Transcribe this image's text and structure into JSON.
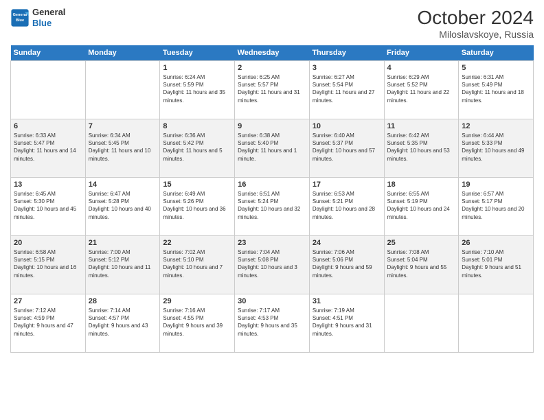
{
  "header": {
    "logo_line1": "General",
    "logo_line2": "Blue",
    "month": "October 2024",
    "location": "Miloslavskoye, Russia"
  },
  "days": [
    "Sunday",
    "Monday",
    "Tuesday",
    "Wednesday",
    "Thursday",
    "Friday",
    "Saturday"
  ],
  "weeks": [
    [
      {
        "day": "",
        "sunrise": "",
        "sunset": "",
        "daylight": ""
      },
      {
        "day": "",
        "sunrise": "",
        "sunset": "",
        "daylight": ""
      },
      {
        "day": "1",
        "sunrise": "Sunrise: 6:24 AM",
        "sunset": "Sunset: 5:59 PM",
        "daylight": "Daylight: 11 hours and 35 minutes."
      },
      {
        "day": "2",
        "sunrise": "Sunrise: 6:25 AM",
        "sunset": "Sunset: 5:57 PM",
        "daylight": "Daylight: 11 hours and 31 minutes."
      },
      {
        "day": "3",
        "sunrise": "Sunrise: 6:27 AM",
        "sunset": "Sunset: 5:54 PM",
        "daylight": "Daylight: 11 hours and 27 minutes."
      },
      {
        "day": "4",
        "sunrise": "Sunrise: 6:29 AM",
        "sunset": "Sunset: 5:52 PM",
        "daylight": "Daylight: 11 hours and 22 minutes."
      },
      {
        "day": "5",
        "sunrise": "Sunrise: 6:31 AM",
        "sunset": "Sunset: 5:49 PM",
        "daylight": "Daylight: 11 hours and 18 minutes."
      }
    ],
    [
      {
        "day": "6",
        "sunrise": "Sunrise: 6:33 AM",
        "sunset": "Sunset: 5:47 PM",
        "daylight": "Daylight: 11 hours and 14 minutes."
      },
      {
        "day": "7",
        "sunrise": "Sunrise: 6:34 AM",
        "sunset": "Sunset: 5:45 PM",
        "daylight": "Daylight: 11 hours and 10 minutes."
      },
      {
        "day": "8",
        "sunrise": "Sunrise: 6:36 AM",
        "sunset": "Sunset: 5:42 PM",
        "daylight": "Daylight: 11 hours and 5 minutes."
      },
      {
        "day": "9",
        "sunrise": "Sunrise: 6:38 AM",
        "sunset": "Sunset: 5:40 PM",
        "daylight": "Daylight: 11 hours and 1 minute."
      },
      {
        "day": "10",
        "sunrise": "Sunrise: 6:40 AM",
        "sunset": "Sunset: 5:37 PM",
        "daylight": "Daylight: 10 hours and 57 minutes."
      },
      {
        "day": "11",
        "sunrise": "Sunrise: 6:42 AM",
        "sunset": "Sunset: 5:35 PM",
        "daylight": "Daylight: 10 hours and 53 minutes."
      },
      {
        "day": "12",
        "sunrise": "Sunrise: 6:44 AM",
        "sunset": "Sunset: 5:33 PM",
        "daylight": "Daylight: 10 hours and 49 minutes."
      }
    ],
    [
      {
        "day": "13",
        "sunrise": "Sunrise: 6:45 AM",
        "sunset": "Sunset: 5:30 PM",
        "daylight": "Daylight: 10 hours and 45 minutes."
      },
      {
        "day": "14",
        "sunrise": "Sunrise: 6:47 AM",
        "sunset": "Sunset: 5:28 PM",
        "daylight": "Daylight: 10 hours and 40 minutes."
      },
      {
        "day": "15",
        "sunrise": "Sunrise: 6:49 AM",
        "sunset": "Sunset: 5:26 PM",
        "daylight": "Daylight: 10 hours and 36 minutes."
      },
      {
        "day": "16",
        "sunrise": "Sunrise: 6:51 AM",
        "sunset": "Sunset: 5:24 PM",
        "daylight": "Daylight: 10 hours and 32 minutes."
      },
      {
        "day": "17",
        "sunrise": "Sunrise: 6:53 AM",
        "sunset": "Sunset: 5:21 PM",
        "daylight": "Daylight: 10 hours and 28 minutes."
      },
      {
        "day": "18",
        "sunrise": "Sunrise: 6:55 AM",
        "sunset": "Sunset: 5:19 PM",
        "daylight": "Daylight: 10 hours and 24 minutes."
      },
      {
        "day": "19",
        "sunrise": "Sunrise: 6:57 AM",
        "sunset": "Sunset: 5:17 PM",
        "daylight": "Daylight: 10 hours and 20 minutes."
      }
    ],
    [
      {
        "day": "20",
        "sunrise": "Sunrise: 6:58 AM",
        "sunset": "Sunset: 5:15 PM",
        "daylight": "Daylight: 10 hours and 16 minutes."
      },
      {
        "day": "21",
        "sunrise": "Sunrise: 7:00 AM",
        "sunset": "Sunset: 5:12 PM",
        "daylight": "Daylight: 10 hours and 11 minutes."
      },
      {
        "day": "22",
        "sunrise": "Sunrise: 7:02 AM",
        "sunset": "Sunset: 5:10 PM",
        "daylight": "Daylight: 10 hours and 7 minutes."
      },
      {
        "day": "23",
        "sunrise": "Sunrise: 7:04 AM",
        "sunset": "Sunset: 5:08 PM",
        "daylight": "Daylight: 10 hours and 3 minutes."
      },
      {
        "day": "24",
        "sunrise": "Sunrise: 7:06 AM",
        "sunset": "Sunset: 5:06 PM",
        "daylight": "Daylight: 9 hours and 59 minutes."
      },
      {
        "day": "25",
        "sunrise": "Sunrise: 7:08 AM",
        "sunset": "Sunset: 5:04 PM",
        "daylight": "Daylight: 9 hours and 55 minutes."
      },
      {
        "day": "26",
        "sunrise": "Sunrise: 7:10 AM",
        "sunset": "Sunset: 5:01 PM",
        "daylight": "Daylight: 9 hours and 51 minutes."
      }
    ],
    [
      {
        "day": "27",
        "sunrise": "Sunrise: 7:12 AM",
        "sunset": "Sunset: 4:59 PM",
        "daylight": "Daylight: 9 hours and 47 minutes."
      },
      {
        "day": "28",
        "sunrise": "Sunrise: 7:14 AM",
        "sunset": "Sunset: 4:57 PM",
        "daylight": "Daylight: 9 hours and 43 minutes."
      },
      {
        "day": "29",
        "sunrise": "Sunrise: 7:16 AM",
        "sunset": "Sunset: 4:55 PM",
        "daylight": "Daylight: 9 hours and 39 minutes."
      },
      {
        "day": "30",
        "sunrise": "Sunrise: 7:17 AM",
        "sunset": "Sunset: 4:53 PM",
        "daylight": "Daylight: 9 hours and 35 minutes."
      },
      {
        "day": "31",
        "sunrise": "Sunrise: 7:19 AM",
        "sunset": "Sunset: 4:51 PM",
        "daylight": "Daylight: 9 hours and 31 minutes."
      },
      {
        "day": "",
        "sunrise": "",
        "sunset": "",
        "daylight": ""
      },
      {
        "day": "",
        "sunrise": "",
        "sunset": "",
        "daylight": ""
      }
    ]
  ]
}
